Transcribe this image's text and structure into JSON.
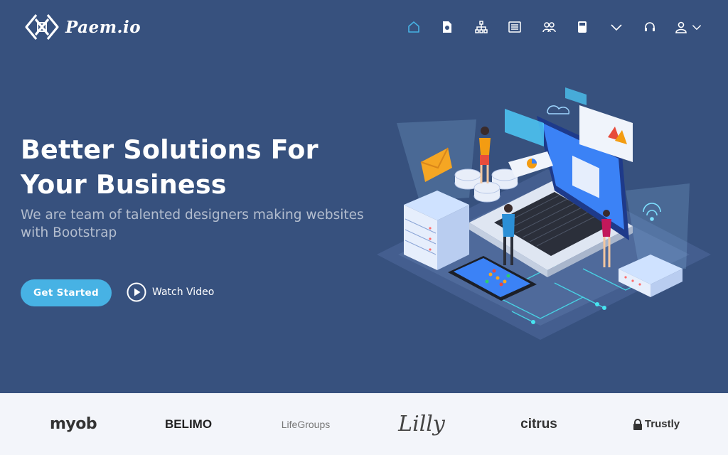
{
  "brand": {
    "name": "Paem.io",
    "logo_icon": "bracket-x-icon"
  },
  "nav": {
    "items": [
      {
        "icon": "home-icon",
        "active": true
      },
      {
        "icon": "document-icon"
      },
      {
        "icon": "sitemap-icon"
      },
      {
        "icon": "list-icon"
      },
      {
        "icon": "team-icon"
      },
      {
        "icon": "calculator-icon"
      },
      {
        "icon": "chevron-down-icon"
      },
      {
        "icon": "headset-icon"
      },
      {
        "icon": "user-icon"
      }
    ]
  },
  "hero": {
    "headline_line1": "Better Solutions For",
    "headline_line2": "Your Business",
    "subheadline": "We are team of talented designers making websites with Bootstrap",
    "cta_label": "Get Started",
    "video_label": "Watch Video"
  },
  "clients": [
    "myob",
    "BELIMO",
    "LifeGroups",
    "Lilly",
    "citrus",
    "Trustly"
  ],
  "colors": {
    "hero_bg": "#37517e",
    "accent": "#47b2e4",
    "nav_active": "#47b2e4",
    "clients_bg": "#f3f5fa"
  }
}
